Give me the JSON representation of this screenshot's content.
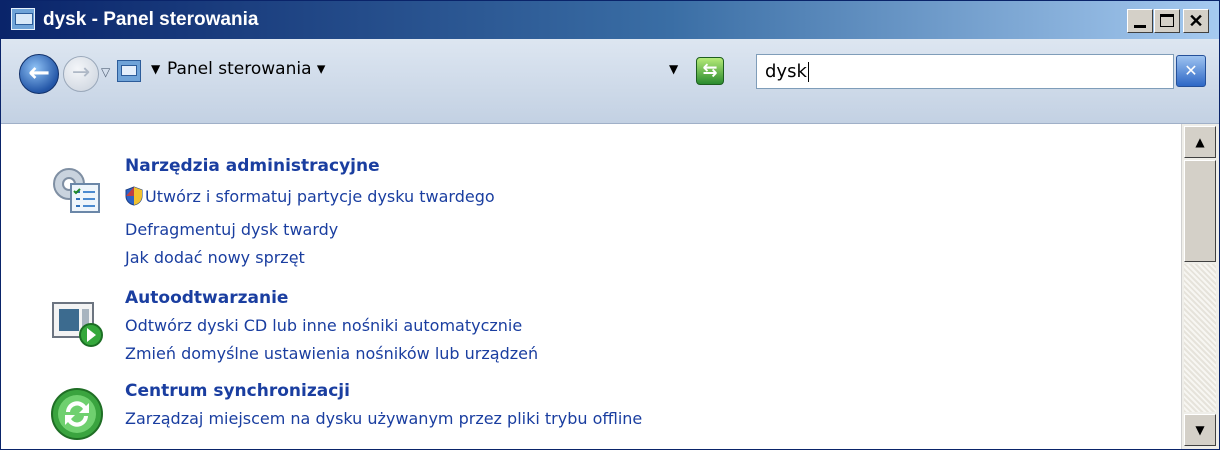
{
  "window": {
    "title": "dysk - Panel sterowania"
  },
  "navigation": {
    "breadcrumb": "Panel sterowania"
  },
  "search": {
    "value": "dysk"
  },
  "results": [
    {
      "title": "Narzędzia administracyjne",
      "icon": "admin-tools-icon",
      "tasks": [
        {
          "label": "Utwórz i sformatuj partycje dysku twardego",
          "shield": true
        },
        {
          "label": "Defragmentuj dysk twardy"
        },
        {
          "label": "Jak dodać nowy sprzęt"
        }
      ]
    },
    {
      "title": "Autoodtwarzanie",
      "icon": "autoplay-icon",
      "tasks": [
        {
          "label": "Odtwórz dyski CD lub inne nośniki automatycznie"
        },
        {
          "label": "Zmień domyślne ustawienia nośników lub urządzeń"
        }
      ]
    },
    {
      "title": "Centrum synchronizacji",
      "icon": "sync-center-icon",
      "tasks": [
        {
          "label": "Zarządzaj miejscem na dysku używanym przez pliki trybu offline"
        }
      ]
    }
  ]
}
